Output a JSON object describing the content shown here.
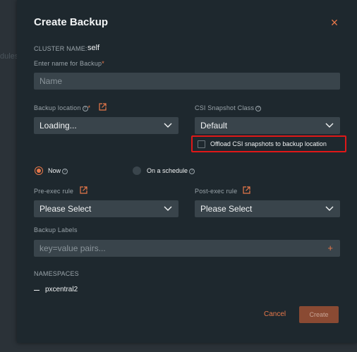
{
  "backdrop": {
    "fragment": "dules"
  },
  "dialog": {
    "title": "Create Backup",
    "close_glyph": "×",
    "cluster_label": "CLUSTER NAME:",
    "cluster_value": "self",
    "name_label": "Enter name for Backup",
    "name_placeholder": "Name",
    "required_mark": "*",
    "backup_location_label": "Backup location",
    "backup_location_value": "Loading...",
    "csi_label": "CSI Snapshot Class",
    "csi_value": "Default",
    "offload_label": "Offload CSI snapshots to backup location",
    "offload_checked": false,
    "schedule_now_label": "Now",
    "schedule_cron_label": "On a schedule",
    "schedule_selected": "Now",
    "pre_exec_label": "Pre-exec rule",
    "pre_exec_value": "Please Select",
    "post_exec_label": "Post-exec rule",
    "post_exec_value": "Please Select",
    "labels_label": "Backup Labels",
    "labels_placeholder": "key=value pairs...",
    "labels_add": "+",
    "namespaces_label": "NAMESPACES",
    "namespaces": [
      "pxcentral2"
    ],
    "cancel_label": "Cancel",
    "create_label": "Create",
    "help_glyph": "?"
  },
  "colors": {
    "accent": "#e8784a",
    "highlight_box": "#e01818",
    "modal_bg": "#1e282e",
    "field_bg": "#39444b"
  },
  "icons": {
    "close": "close-icon",
    "help": "help-circle-icon",
    "external": "external-link-icon",
    "chevron": "chevron-down-icon",
    "plus": "plus-icon"
  }
}
